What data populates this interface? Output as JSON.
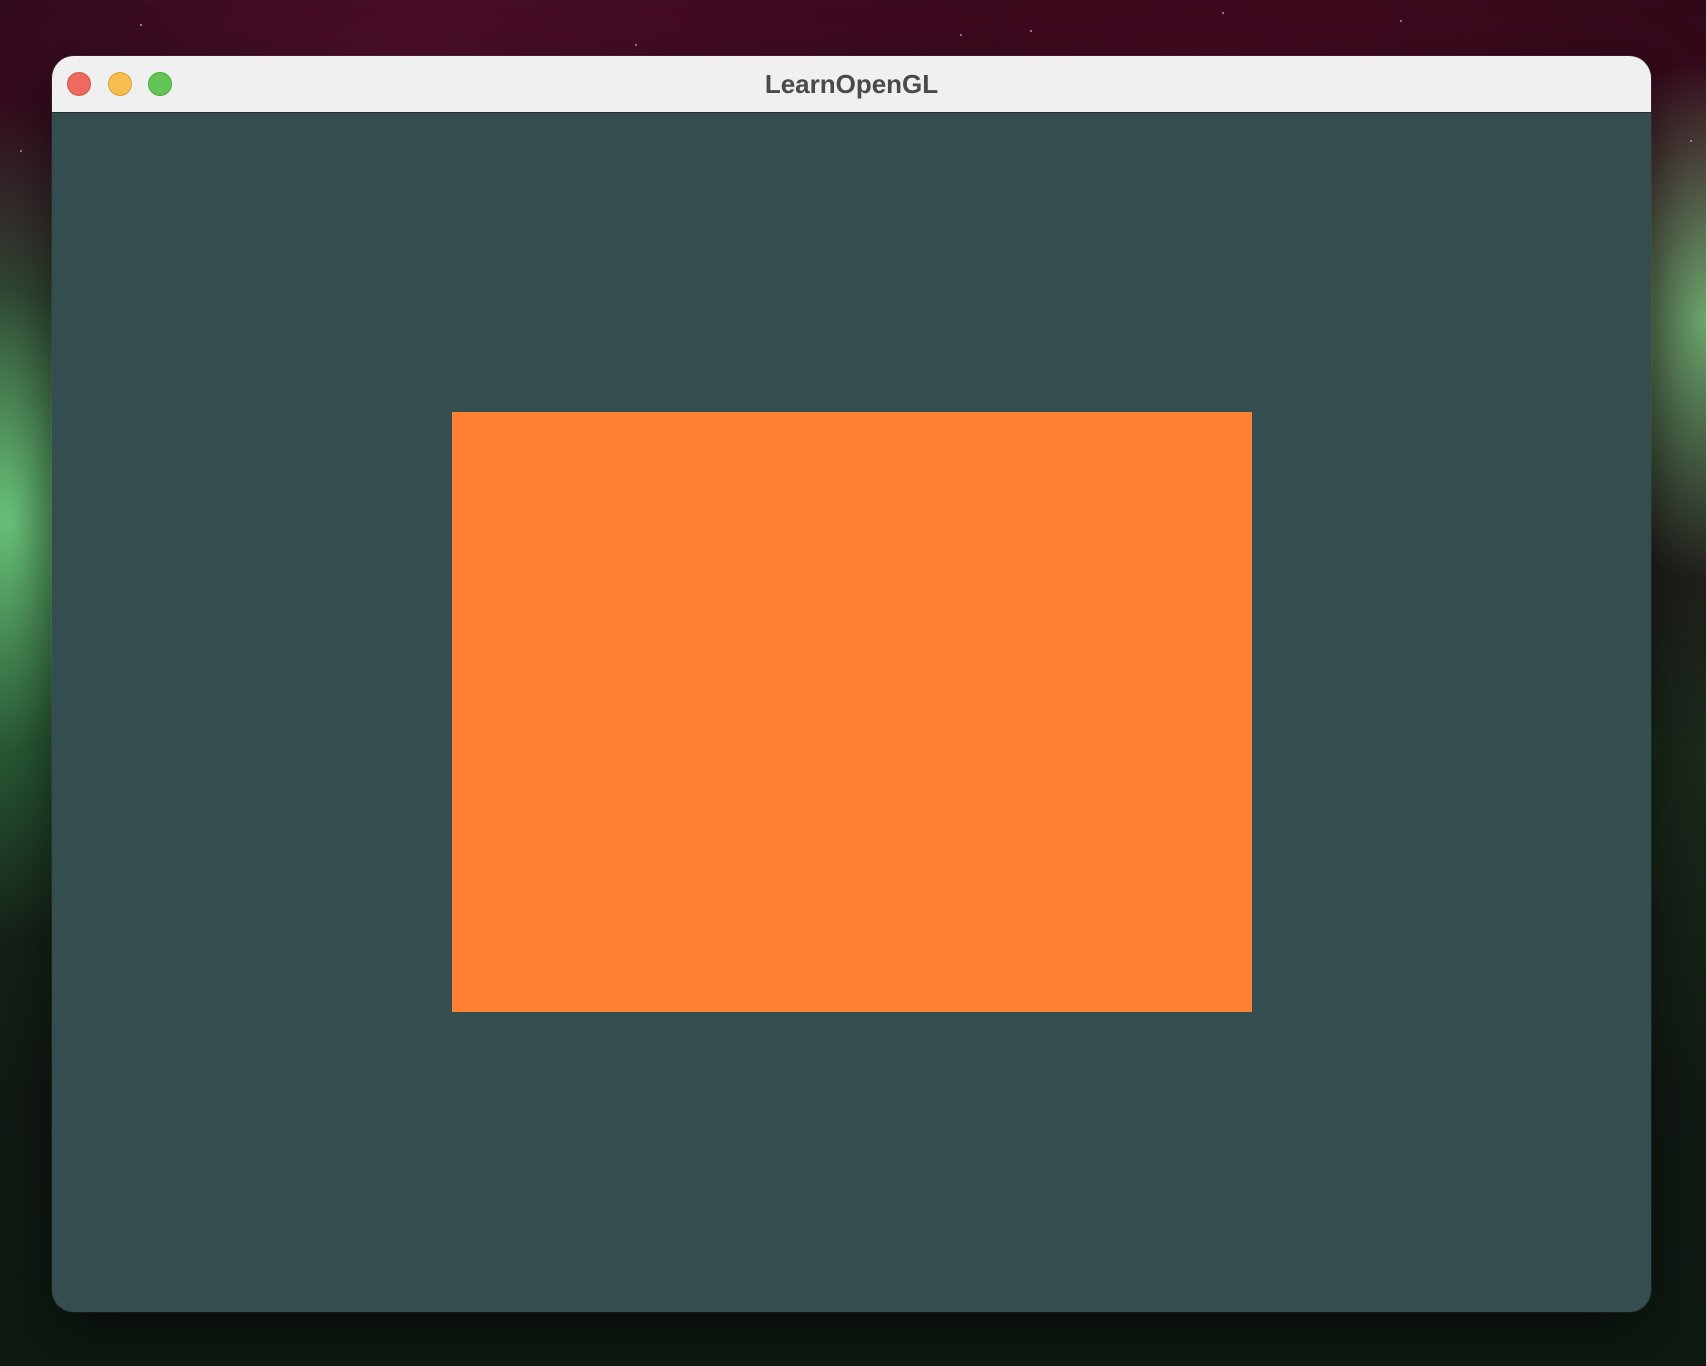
{
  "window": {
    "title": "LearnOpenGL",
    "buttons": {
      "close": "close-icon",
      "minimize": "minimize-icon",
      "maximize": "maximize-icon"
    }
  },
  "colors": {
    "clear_color": "#344e4f",
    "rectangle_color": "#ff8033",
    "titlebar": "#f0f0f0"
  }
}
